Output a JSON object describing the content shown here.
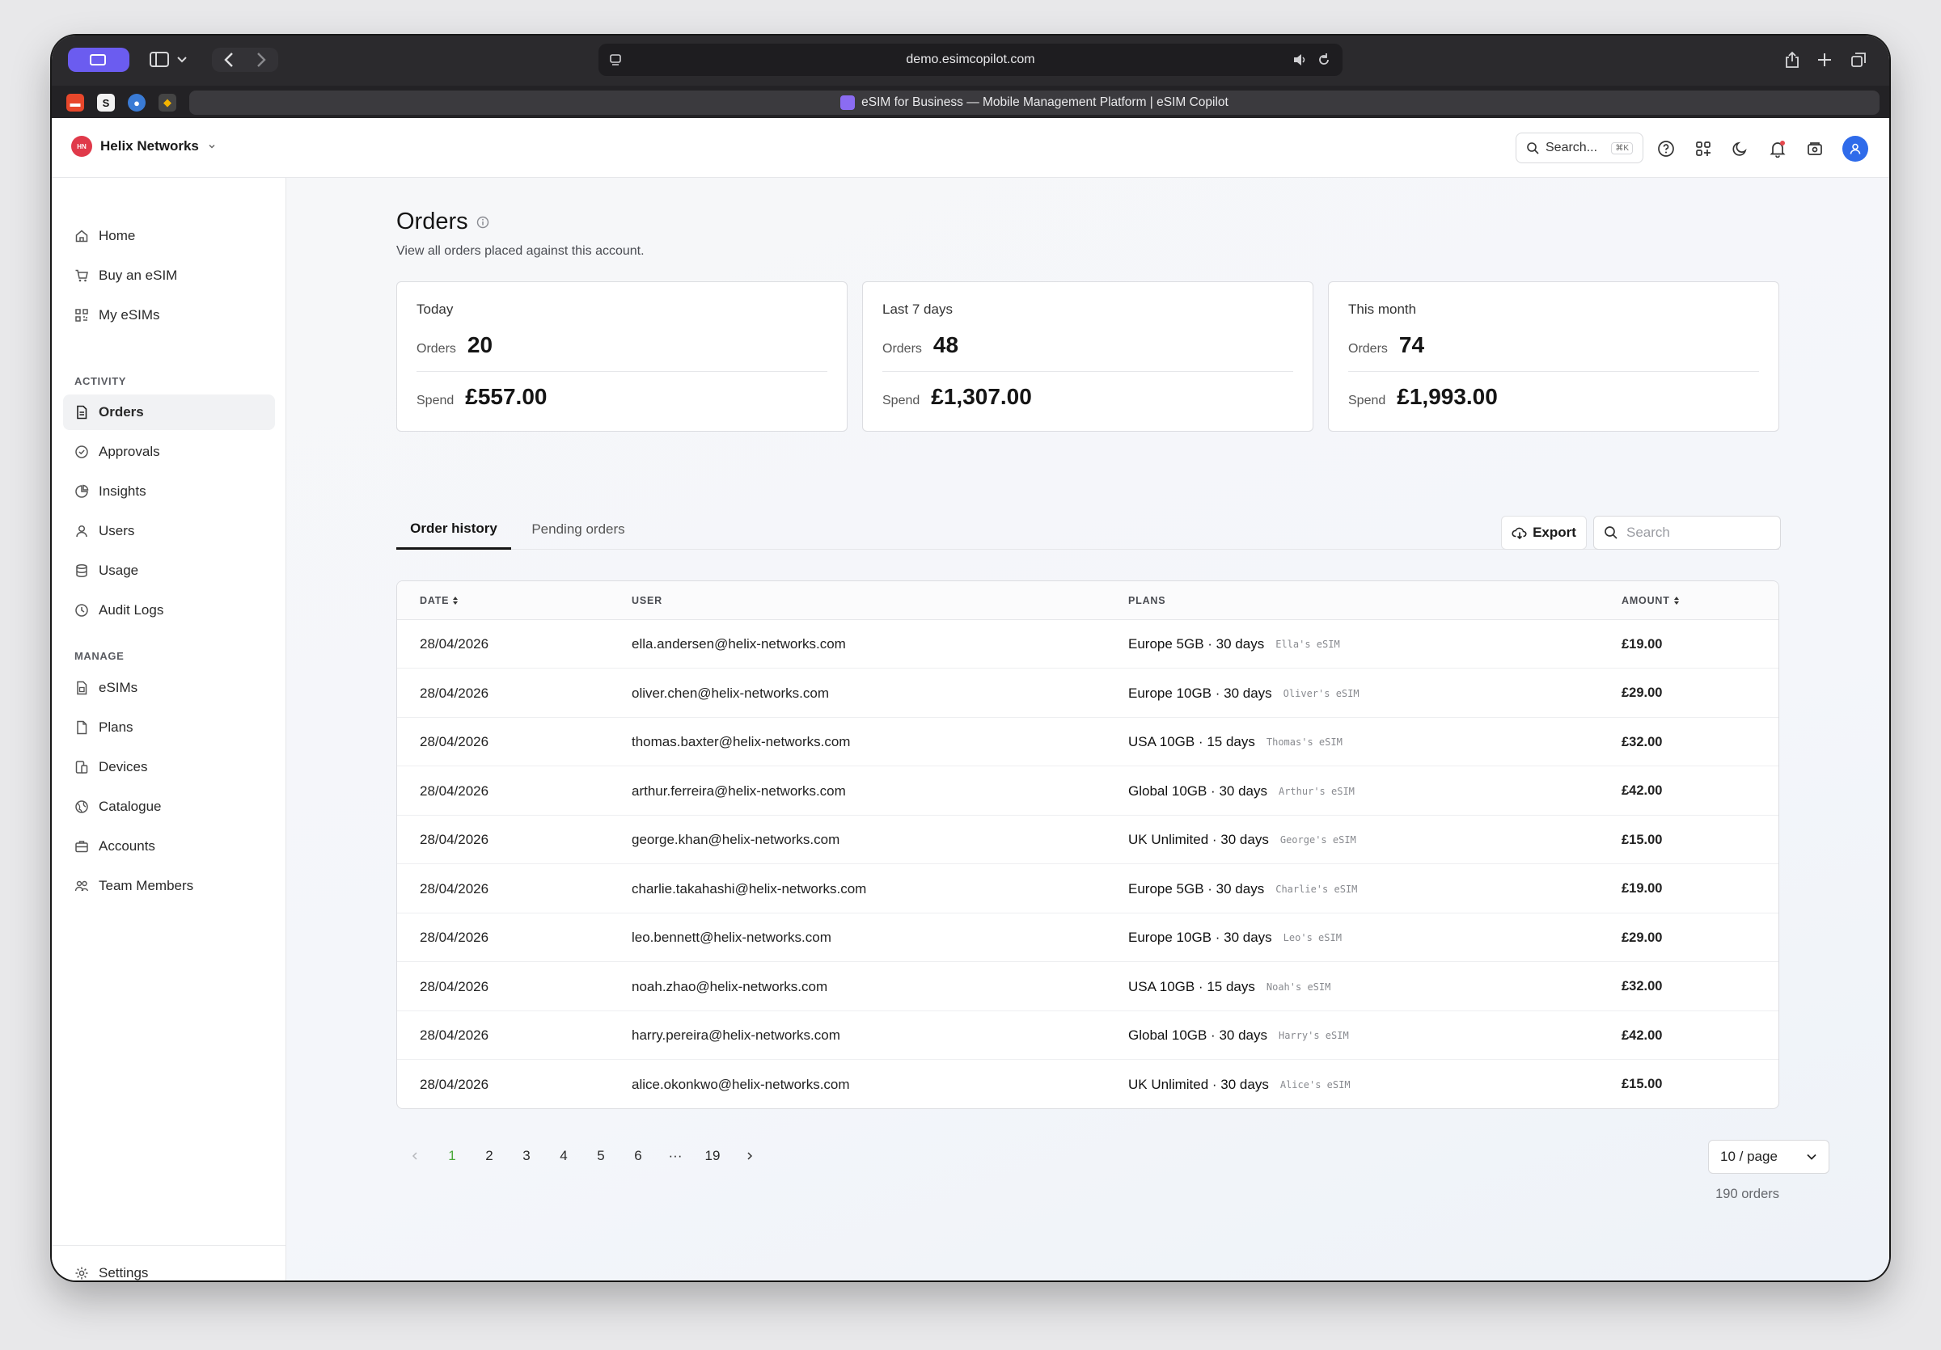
{
  "browser": {
    "url": "demo.esimcopilot.com",
    "tab_title": "eSIM for Business — Mobile Management Platform | eSIM Copilot"
  },
  "header": {
    "org_initials": "HN",
    "org_name": "Helix Networks",
    "search_label": "Search...",
    "search_shortcut": "⌘K"
  },
  "sidebar": {
    "items_top": [
      {
        "label": "Home",
        "icon": "home-icon"
      },
      {
        "label": "Buy an eSIM",
        "icon": "cart-icon"
      },
      {
        "label": "My eSIMs",
        "icon": "qr-icon"
      }
    ],
    "section_activity": "ACTIVITY",
    "items_activity": [
      {
        "label": "Orders",
        "icon": "document-icon",
        "active": true
      },
      {
        "label": "Approvals",
        "icon": "check-circle-icon"
      },
      {
        "label": "Insights",
        "icon": "pie-chart-icon"
      },
      {
        "label": "Users",
        "icon": "user-icon"
      },
      {
        "label": "Usage",
        "icon": "database-icon"
      },
      {
        "label": "Audit Logs",
        "icon": "clock-icon"
      }
    ],
    "section_manage": "MANAGE",
    "items_manage": [
      {
        "label": "eSIMs",
        "icon": "sim-icon"
      },
      {
        "label": "Plans",
        "icon": "file-icon"
      },
      {
        "label": "Devices",
        "icon": "devices-icon"
      },
      {
        "label": "Catalogue",
        "icon": "globe-icon"
      },
      {
        "label": "Accounts",
        "icon": "briefcase-icon"
      },
      {
        "label": "Team Members",
        "icon": "team-icon"
      }
    ],
    "settings_label": "Settings"
  },
  "page": {
    "title": "Orders",
    "subtitle": "View all orders placed against this account."
  },
  "stats": [
    {
      "period": "Today",
      "orders_label": "Orders",
      "orders": "20",
      "spend_label": "Spend",
      "spend": "£557.00"
    },
    {
      "period": "Last 7 days",
      "orders_label": "Orders",
      "orders": "48",
      "spend_label": "Spend",
      "spend": "£1,307.00"
    },
    {
      "period": "This month",
      "orders_label": "Orders",
      "orders": "74",
      "spend_label": "Spend",
      "spend": "£1,993.00"
    }
  ],
  "tabs": [
    {
      "label": "Order history",
      "active": true
    },
    {
      "label": "Pending orders",
      "active": false
    }
  ],
  "toolbar": {
    "export_label": "Export",
    "search_placeholder": "Search"
  },
  "table": {
    "columns": [
      "DATE",
      "USER",
      "PLANS",
      "AMOUNT"
    ],
    "rows": [
      {
        "date": "28/04/2026",
        "user": "ella.andersen@helix-networks.com",
        "plan": "Europe 5GB · 30 days",
        "esim": "Ella's eSIM",
        "amount": "£19.00"
      },
      {
        "date": "28/04/2026",
        "user": "oliver.chen@helix-networks.com",
        "plan": "Europe 10GB · 30 days",
        "esim": "Oliver's eSIM",
        "amount": "£29.00"
      },
      {
        "date": "28/04/2026",
        "user": "thomas.baxter@helix-networks.com",
        "plan": "USA 10GB · 15 days",
        "esim": "Thomas's eSIM",
        "amount": "£32.00"
      },
      {
        "date": "28/04/2026",
        "user": "arthur.ferreira@helix-networks.com",
        "plan": "Global 10GB · 30 days",
        "esim": "Arthur's eSIM",
        "amount": "£42.00"
      },
      {
        "date": "28/04/2026",
        "user": "george.khan@helix-networks.com",
        "plan": "UK Unlimited · 30 days",
        "esim": "George's eSIM",
        "amount": "£15.00"
      },
      {
        "date": "28/04/2026",
        "user": "charlie.takahashi@helix-networks.com",
        "plan": "Europe 5GB · 30 days",
        "esim": "Charlie's eSIM",
        "amount": "£19.00"
      },
      {
        "date": "28/04/2026",
        "user": "leo.bennett@helix-networks.com",
        "plan": "Europe 10GB · 30 days",
        "esim": "Leo's eSIM",
        "amount": "£29.00"
      },
      {
        "date": "28/04/2026",
        "user": "noah.zhao@helix-networks.com",
        "plan": "USA 10GB · 15 days",
        "esim": "Noah's eSIM",
        "amount": "£32.00"
      },
      {
        "date": "28/04/2026",
        "user": "harry.pereira@helix-networks.com",
        "plan": "Global 10GB · 30 days",
        "esim": "Harry's eSIM",
        "amount": "£42.00"
      },
      {
        "date": "28/04/2026",
        "user": "alice.okonkwo@helix-networks.com",
        "plan": "UK Unlimited · 30 days",
        "esim": "Alice's eSIM",
        "amount": "£15.00"
      }
    ]
  },
  "pagination": {
    "pages": [
      "1",
      "2",
      "3",
      "4",
      "5",
      "6",
      "···",
      "19"
    ],
    "current": "1",
    "per_page": "10 / page",
    "total": "190 orders"
  }
}
